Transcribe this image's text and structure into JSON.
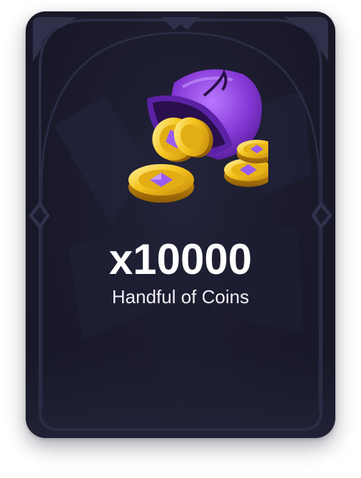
{
  "reward_card": {
    "amount": "x10000",
    "item_name": "Handful of Coins",
    "item_icon": "coin-pouch-icon"
  },
  "colors": {
    "card_background": "#1a1a2b",
    "frame": "#2e2f47",
    "pouch": "#8a3fd6",
    "coin": "#f2c21b",
    "coin_gem": "#9a5cf0",
    "text": "#ffffff"
  }
}
